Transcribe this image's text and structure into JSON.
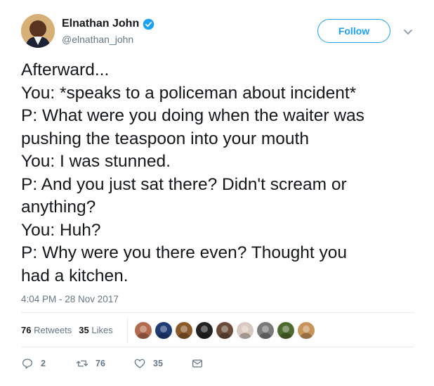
{
  "author": {
    "display_name": "Elnathan John",
    "handle": "@elnathan_john",
    "verified_icon": "verified-badge-icon"
  },
  "follow_label": "Follow",
  "tweet_lines": [
    "Afterward...",
    "You: *speaks to a policeman about incident*",
    "P: What were you doing when the waiter was",
    "pushing the teaspoon into your mouth",
    "You: I was stunned.",
    "P: And you just sat there? Didn't scream or",
    "anything?",
    "You: Huh?",
    "P: Why were you there even? Thought you",
    "had a kitchen."
  ],
  "timestamp": "4:04 PM - 28 Nov 2017",
  "stats": {
    "retweets_count": "76",
    "retweets_label": "Retweets",
    "likes_count": "35",
    "likes_label": "Likes"
  },
  "likers_colors": [
    "#b36b4f",
    "#1f3b73",
    "#8a5a2b",
    "#222222",
    "#6b4a3a",
    "#d9c9c0",
    "#7a7a7a",
    "#4e6b2f",
    "#c7955a"
  ],
  "actions": {
    "reply_count": "2",
    "retweet_count": "76",
    "like_count": "35"
  },
  "colors": {
    "accent": "#1da1f2",
    "muted": "#657786",
    "text": "#14171a"
  }
}
